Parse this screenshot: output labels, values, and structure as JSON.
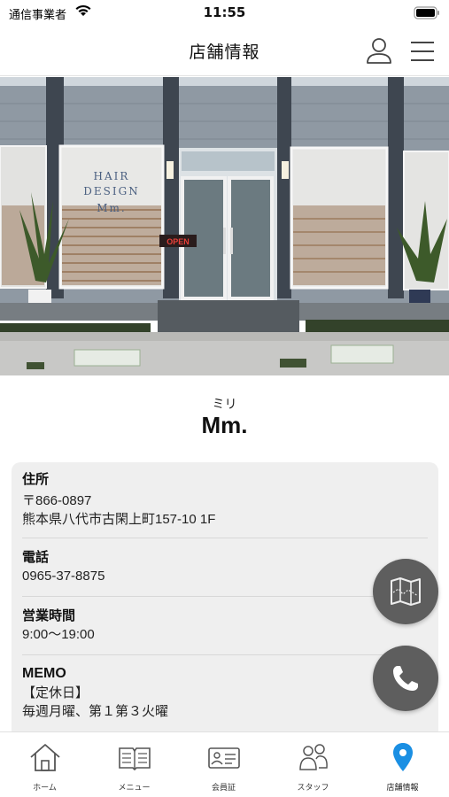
{
  "status_bar": {
    "carrier": "通信事業者",
    "time": "11:55"
  },
  "header": {
    "title": "店舗情報",
    "user_icon": "user-icon",
    "menu_icon": "hamburger-menu-icon"
  },
  "hero": {
    "sign_text": [
      "HAIR",
      "DESIGN",
      "Mm."
    ],
    "open_sign": "OPEN"
  },
  "shop": {
    "reading": "ミリ",
    "name": "Mm."
  },
  "info": {
    "address_label": "住所",
    "postal_code": "〒866-0897",
    "address": "熊本県八代市古閑上町157-10 1F",
    "phone_label": "電話",
    "phone": "0965-37-8875",
    "hours_label": "営業時間",
    "hours": "9:00〜19:00",
    "memo_label": "MEMO",
    "memo_line1": "【定休日】",
    "memo_line2": "毎週月曜、第１第３火曜"
  },
  "fabs": {
    "map_icon": "map-icon",
    "phone_icon": "phone-icon"
  },
  "tabs": [
    {
      "label": "ホーム",
      "icon": "home-icon"
    },
    {
      "label": "メニュー",
      "icon": "book-icon"
    },
    {
      "label": "会員証",
      "icon": "member-card-icon"
    },
    {
      "label": "スタッフ",
      "icon": "staff-icon"
    },
    {
      "label": "店舗情報",
      "icon": "location-pin-icon",
      "active": true
    }
  ],
  "colors": {
    "accent": "#1a8fe3",
    "fab": "#5e5e5e",
    "card": "#efefef"
  }
}
